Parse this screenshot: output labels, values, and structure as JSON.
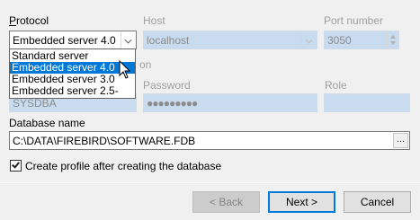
{
  "protocol": {
    "label": "Protocol",
    "selected": "Embedded server 4.0",
    "options": [
      "Standard server",
      "Embedded server 4.0",
      "Embedded server 3.0",
      "Embedded server 2.5-"
    ],
    "selected_index": 1
  },
  "host": {
    "label": "Host",
    "value": "localhost"
  },
  "port": {
    "label": "Port number",
    "value": "3050"
  },
  "auth": {
    "hidden_label_fragment": "on",
    "user_value": "SYSDBA",
    "password_label": "Password",
    "password_value": "●●●●●●●●●",
    "role_label": "Role",
    "role_value": ""
  },
  "database": {
    "label": "Database name",
    "value": "C:\\DATA\\FIREBIRD\\SOFTWARE.FDB",
    "browse_label": "..."
  },
  "create_profile": {
    "label": "Create profile after creating the database",
    "checked": true
  },
  "buttons": {
    "back": "< Back",
    "next": "Next >",
    "cancel": "Cancel"
  },
  "colors": {
    "selection": "#0078d7",
    "disabled_field": "#c9dcef",
    "dialog_bg": "#f0f0f0"
  }
}
